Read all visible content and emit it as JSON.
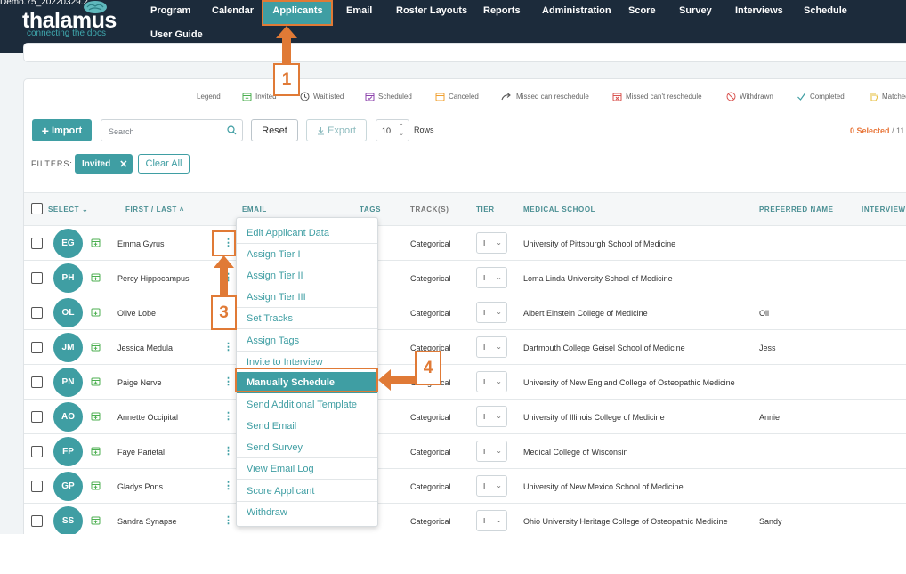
{
  "app": {
    "version": "Demo.75_20220329.2",
    "logo_text": "thalamus",
    "logo_tagline": "connecting the docs"
  },
  "nav": {
    "items": [
      "Program",
      "Calendar",
      "Applicants",
      "Email",
      "Roster Layouts",
      "Reports",
      "Administration",
      "Score",
      "Survey",
      "Interviews",
      "Schedule",
      "User Guide"
    ],
    "active": "Applicants"
  },
  "legend": {
    "title": "Legend",
    "items": [
      {
        "label": "Invited",
        "icon": "calendar-plus-icon",
        "color": "#4caf50"
      },
      {
        "label": "Waitlisted",
        "icon": "clock-icon",
        "color": "#555555"
      },
      {
        "label": "Scheduled",
        "icon": "calendar-check-icon",
        "color": "#8e44ad"
      },
      {
        "label": "Canceled",
        "icon": "calendar-icon",
        "color": "#f0a030"
      },
      {
        "label": "Missed can reschedule",
        "icon": "reschedule-arrow-icon",
        "color": "#555555"
      },
      {
        "label": "Missed can't reschedule",
        "icon": "calendar-x-icon",
        "color": "#d9534f"
      },
      {
        "label": "Withdrawn",
        "icon": "ban-icon",
        "color": "#d9534f"
      },
      {
        "label": "Completed",
        "icon": "check-icon",
        "color": "#3f9ea3"
      },
      {
        "label": "Matched",
        "icon": "hand-icon",
        "color": "#e8c24a"
      }
    ]
  },
  "toolbar": {
    "import_label": "Import",
    "search_placeholder": "Search",
    "reset_label": "Reset",
    "export_label": "Export",
    "rows_value": "10",
    "rows_label": "Rows",
    "selected_count": "0 Selected",
    "selected_total": "/ 11"
  },
  "filters": {
    "label": "FILTERS:",
    "chips": [
      "Invited"
    ],
    "clear_label": "Clear All"
  },
  "table": {
    "headers": [
      "SELECT",
      "FIRST / LAST",
      "EMAIL",
      "TAGS",
      "TRACK(S)",
      "TIER",
      "MEDICAL SCHOOL",
      "PREFERRED NAME",
      "INTERVIEW"
    ],
    "rows": [
      {
        "initials": "EG",
        "name": "Emma Gyrus",
        "track": "Categorical",
        "tier": "I",
        "school": "University of Pittsburgh School of Medicine",
        "preferred": ""
      },
      {
        "initials": "PH",
        "name": "Percy Hippocampus",
        "track": "Categorical",
        "tier": "I",
        "school": "Loma Linda University School of Medicine",
        "preferred": ""
      },
      {
        "initials": "OL",
        "name": "Olive Lobe",
        "track": "Categorical",
        "tier": "I",
        "school": "Albert Einstein College of Medicine",
        "preferred": "Oli"
      },
      {
        "initials": "JM",
        "name": "Jessica Medula",
        "track": "Categorical",
        "tier": "I",
        "school": "Dartmouth College Geisel School of Medicine",
        "preferred": "Jess"
      },
      {
        "initials": "PN",
        "name": "Paige Nerve",
        "track": "Categorical",
        "tier": "I",
        "school": "University of New England College of Osteopathic Medicine",
        "preferred": ""
      },
      {
        "initials": "AO",
        "name": "Annette Occipital",
        "track": "Categorical",
        "tier": "I",
        "school": "University of Illinois College of Medicine",
        "preferred": "Annie"
      },
      {
        "initials": "FP",
        "name": "Faye Parietal",
        "track": "Categorical",
        "tier": "I",
        "school": "Medical College of Wisconsin",
        "preferred": ""
      },
      {
        "initials": "GP",
        "name": "Gladys Pons",
        "track": "Categorical",
        "tier": "I",
        "school": "University of New Mexico School of Medicine",
        "preferred": ""
      },
      {
        "initials": "SS",
        "name": "Sandra Synapse",
        "track": "Categorical",
        "tier": "I",
        "school": "Ohio University Heritage College of Osteopathic Medicine",
        "preferred": "Sandy"
      }
    ]
  },
  "menu": {
    "items": [
      "Edit Applicant Data",
      "Assign Tier I",
      "Assign Tier II",
      "Assign Tier III",
      "Set Tracks",
      "Assign Tags",
      "Invite to Interview",
      "Manually Schedule",
      "Send Additional Template",
      "Send Email",
      "Send Survey",
      "View Email Log",
      "Score Applicant",
      "Withdraw"
    ],
    "highlighted": "Manually Schedule"
  },
  "annotations": {
    "steps": [
      "1",
      "3",
      "4"
    ],
    "color": "#e07a36"
  }
}
